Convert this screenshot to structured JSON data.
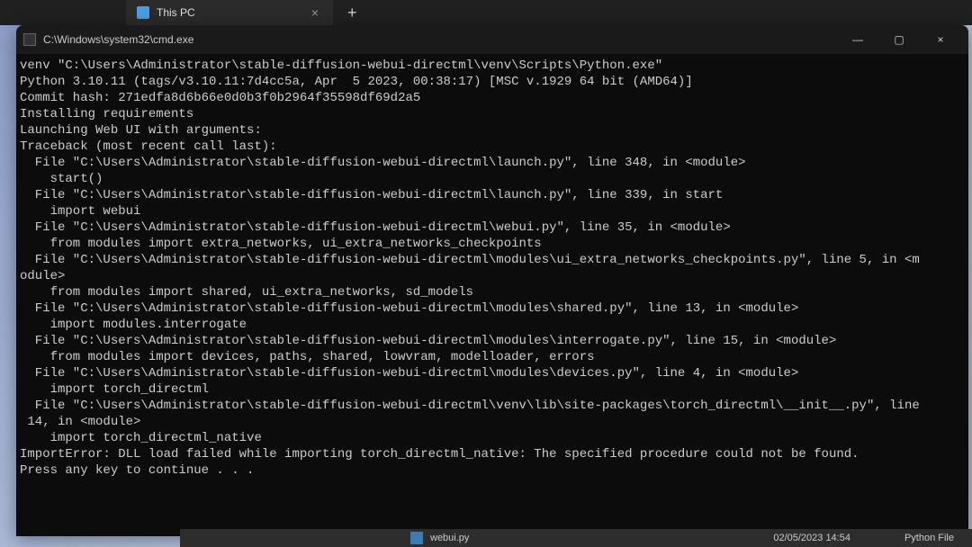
{
  "tab": {
    "title": "This PC",
    "close": "×",
    "new": "+"
  },
  "cmd": {
    "title": "C:\\Windows\\system32\\cmd.exe",
    "controls": {
      "minimize": "—",
      "maximize": "▢",
      "close": "×"
    },
    "lines": [
      "venv \"C:\\Users\\Administrator\\stable-diffusion-webui-directml\\venv\\Scripts\\Python.exe\"",
      "Python 3.10.11 (tags/v3.10.11:7d4cc5a, Apr  5 2023, 00:38:17) [MSC v.1929 64 bit (AMD64)]",
      "Commit hash: 271edfa8d6b66e0d0b3f0b2964f35598df69d2a5",
      "Installing requirements",
      "Launching Web UI with arguments:",
      "Traceback (most recent call last):",
      "  File \"C:\\Users\\Administrator\\stable-diffusion-webui-directml\\launch.py\", line 348, in <module>",
      "    start()",
      "  File \"C:\\Users\\Administrator\\stable-diffusion-webui-directml\\launch.py\", line 339, in start",
      "    import webui",
      "  File \"C:\\Users\\Administrator\\stable-diffusion-webui-directml\\webui.py\", line 35, in <module>",
      "    from modules import extra_networks, ui_extra_networks_checkpoints",
      "  File \"C:\\Users\\Administrator\\stable-diffusion-webui-directml\\modules\\ui_extra_networks_checkpoints.py\", line 5, in <m",
      "odule>",
      "    from modules import shared, ui_extra_networks, sd_models",
      "  File \"C:\\Users\\Administrator\\stable-diffusion-webui-directml\\modules\\shared.py\", line 13, in <module>",
      "    import modules.interrogate",
      "  File \"C:\\Users\\Administrator\\stable-diffusion-webui-directml\\modules\\interrogate.py\", line 15, in <module>",
      "    from modules import devices, paths, shared, lowvram, modelloader, errors",
      "  File \"C:\\Users\\Administrator\\stable-diffusion-webui-directml\\modules\\devices.py\", line 4, in <module>",
      "    import torch_directml",
      "  File \"C:\\Users\\Administrator\\stable-diffusion-webui-directml\\venv\\lib\\site-packages\\torch_directml\\__init__.py\", line",
      " 14, in <module>",
      "    import torch_directml_native",
      "ImportError: DLL load failed while importing torch_directml_native: The specified procedure could not be found.",
      "Press any key to continue . . ."
    ]
  },
  "bg_explorer": {
    "file_name": "webui.py",
    "file_date": "02/05/2023 14:54",
    "file_type": "Python File"
  }
}
